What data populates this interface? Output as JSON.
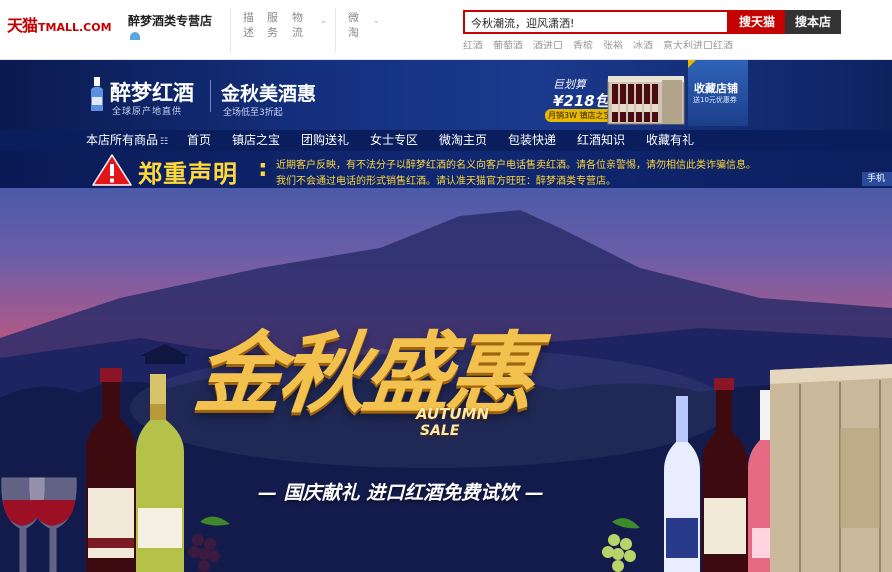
{
  "header": {
    "logo_cn": "天猫",
    "logo_en": "TMALL.COM",
    "shop_name": "醉梦酒类专营店",
    "menu_1": "描述",
    "menu_2": "服务",
    "menu_3": "物流",
    "menu_4": "微淘",
    "search": {
      "value": "今秋潮流，迎风潇洒!",
      "btn_tmall": "搜天猫",
      "btn_shop": "搜本店"
    },
    "hotwords": [
      "红酒",
      "葡萄酒",
      "酒进口",
      "香槟",
      "张裕",
      "冰酒",
      "意大利进口红酒"
    ]
  },
  "banner": {
    "brand_name": "醉梦红酒",
    "brand_sub": "全球原产地直供",
    "promo_title": "金秋美酒惠",
    "promo_sub": "全场低至3折起",
    "jhs_title": "巨划算",
    "jhs_price": "¥218包邮",
    "jhs_note": "月销3W 镇店之宝",
    "fav_title": "收藏店铺",
    "fav_sub": "送10元优惠券"
  },
  "nav": {
    "items": [
      "本店所有商品",
      "首页",
      "镇店之宝",
      "团购送礼",
      "女士专区",
      "微淘主页",
      "包装快递",
      "红酒知识",
      "收藏有礼"
    ],
    "edge_text": "手机"
  },
  "notice": {
    "title": "郑重声明",
    "line1": "近期客户反映，有不法分子以醉梦红酒的名义向客户电话售卖红酒。请各位亲警惕，请勿相信此类诈骗信息。",
    "line2": "我们不会通过电话的形式销售红酒。请认准天猫官方旺旺：醉梦酒类专营店。",
    "side_tag": "手机"
  },
  "hero": {
    "big": "金秋盛惠",
    "autumn": "AUTUMN",
    "sale": "SALE",
    "sub": "— 国庆献礼 进口红酒免费试饮 —"
  },
  "colors": {
    "tmall_red": "#c40000",
    "nav_blue": "#0a1e5e",
    "notice_yellow": "#ffd83a",
    "hero_gold": "#f3c24e"
  }
}
